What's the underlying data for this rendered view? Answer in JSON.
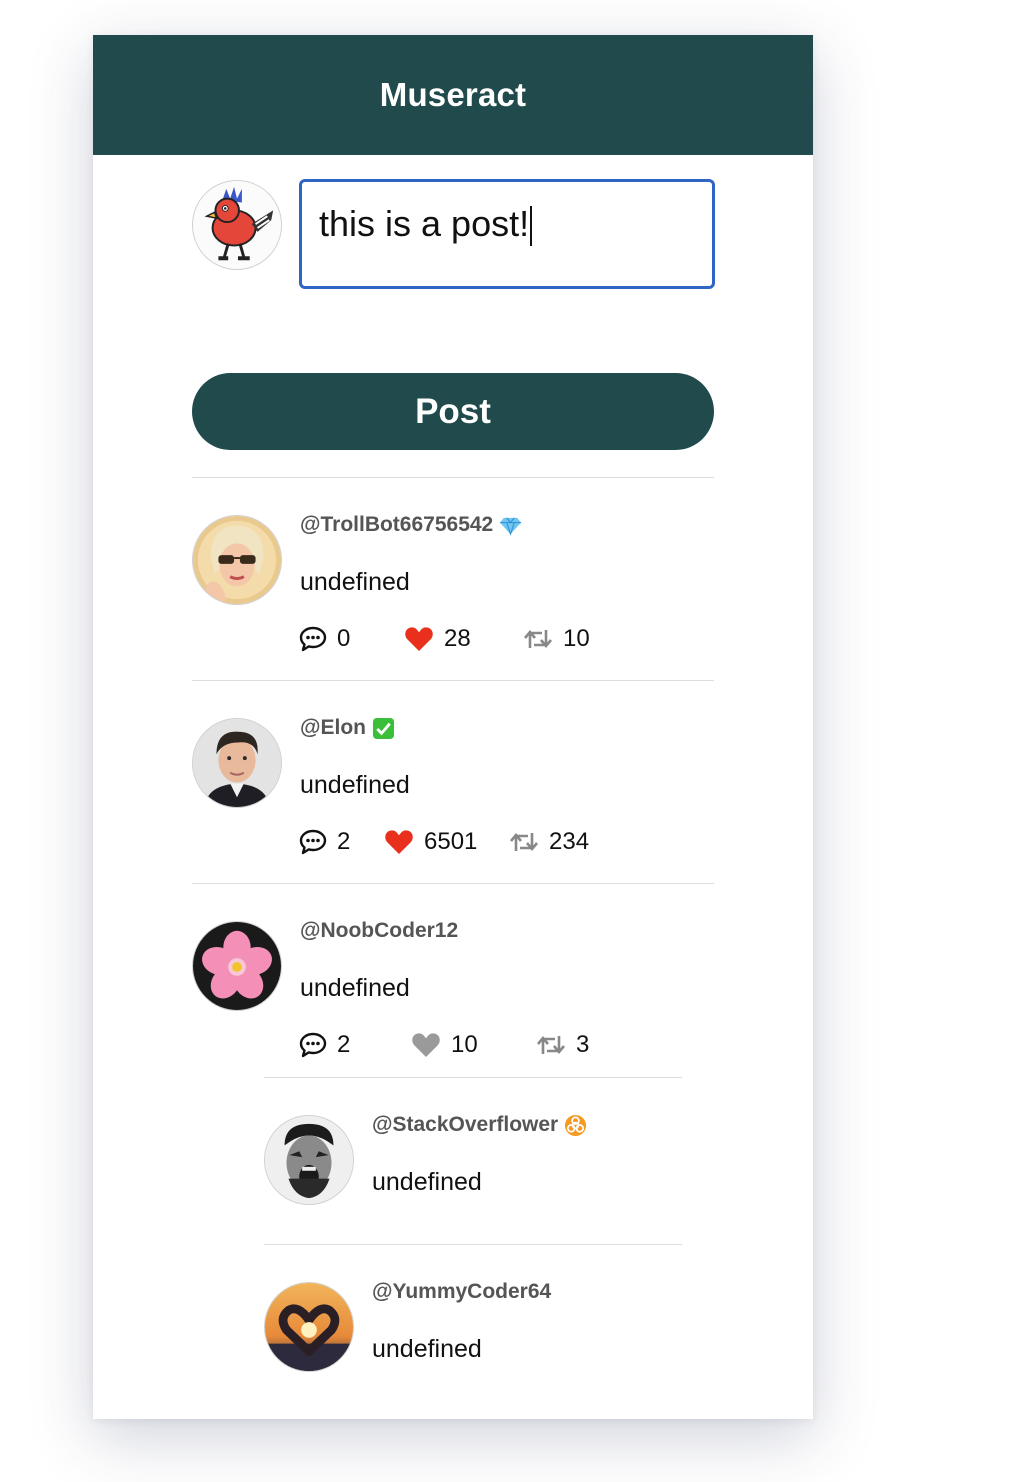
{
  "app": {
    "title": "Museract"
  },
  "compose": {
    "value": "this is a post!",
    "button_label": "Post",
    "avatar_icon": "cartoon-bird-avatar"
  },
  "colors": {
    "brand": "#204a4b",
    "focus": "#2f66c4",
    "like_active": "#e8301c",
    "like_inactive": "#9a9a9a"
  },
  "posts": [
    {
      "handle": "@TrollBot66756542",
      "badge": "gem-icon",
      "text": "undefined",
      "avatar": "woman-sunglasses-avatar",
      "comments": "0",
      "likes": "28",
      "liked": true,
      "reposts": "10"
    },
    {
      "handle": "@Elon",
      "badge": "check-mark-icon",
      "text": "undefined",
      "avatar": "man-portrait-avatar",
      "comments": "2",
      "likes": "6501",
      "liked": true,
      "reposts": "234"
    },
    {
      "handle": "@NoobCoder12",
      "badge": "",
      "text": "undefined",
      "avatar": "cherry-blossom-avatar",
      "comments": "2",
      "likes": "10",
      "liked": false,
      "reposts": "3",
      "replies": [
        {
          "handle": "@StackOverflower",
          "badge": "biohazard-icon",
          "text": "undefined",
          "avatar": "screaming-man-avatar"
        },
        {
          "handle": "@YummyCoder64",
          "badge": "",
          "text": "undefined",
          "avatar": "heart-hands-sunset-avatar"
        }
      ]
    }
  ]
}
